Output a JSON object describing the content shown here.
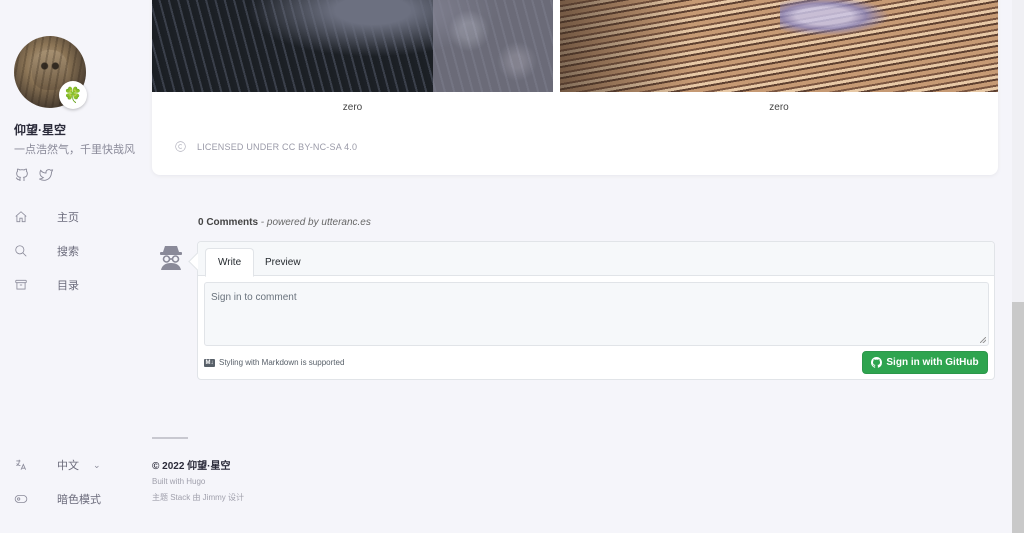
{
  "sidebar": {
    "site_name": "仰望·星空",
    "site_desc": "一点浩然气，千里快哉风",
    "avatar_emoji": "🍀",
    "social": [
      "github-icon",
      "twitter-icon"
    ],
    "menu": [
      {
        "icon": "home-icon",
        "label": "主页"
      },
      {
        "icon": "search-icon",
        "label": "搜索"
      },
      {
        "icon": "archive-icon",
        "label": "目录"
      }
    ],
    "language": {
      "icon": "language-icon",
      "label": "中文"
    },
    "dark_mode": {
      "icon": "toggle-icon",
      "label": "暗色模式"
    }
  },
  "article": {
    "captions": [
      "zero",
      "zero"
    ],
    "license": "LICENSED UNDER CC BY-NC-SA 4.0"
  },
  "comments": {
    "count": "0 Comments",
    "powered_by": "- powered by utteranc.es",
    "tabs": {
      "write": "Write",
      "preview": "Preview"
    },
    "textarea_placeholder": "Sign in to comment",
    "markdown_note": "Styling with Markdown is supported",
    "signin_button": "Sign in with GitHub",
    "accent": "#2ea44f"
  },
  "footer": {
    "copyright": "© 2022 仰望·星空",
    "built_with": "Built with Hugo",
    "theme": "主题 Stack 由 Jimmy 设计"
  }
}
